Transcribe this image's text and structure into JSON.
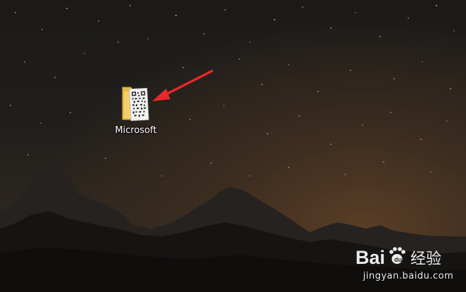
{
  "desktop": {
    "icon": {
      "label": "Microsoft",
      "icon": "folder-icon"
    }
  },
  "annotation": {
    "icon": "red-arrow-icon",
    "color": "#e8282a"
  },
  "watermark": {
    "brand": "Baidu经验",
    "url": "jingyan.baidu.com"
  }
}
